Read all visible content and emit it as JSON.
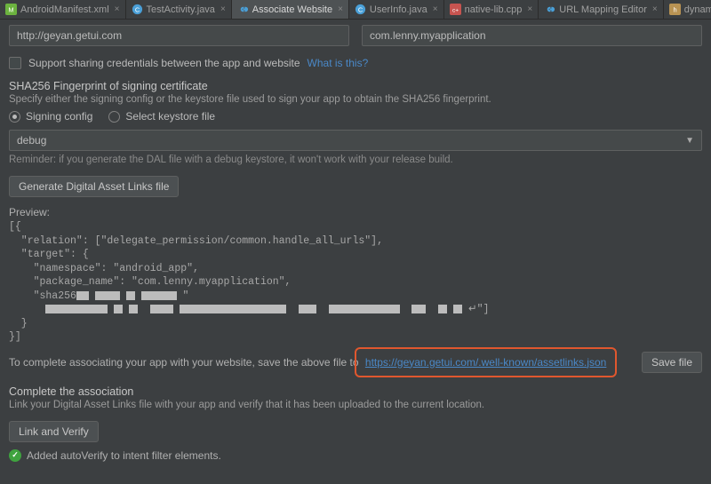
{
  "tabs": [
    {
      "label": "AndroidManifest.xml",
      "iconColor": "#6cb33f"
    },
    {
      "label": "TestActivity.java",
      "iconColor": "#4aa0d8"
    },
    {
      "label": "Associate Website",
      "iconColor": "#4aa0d8",
      "active": true
    },
    {
      "label": "UserInfo.java",
      "iconColor": "#4aa0d8"
    },
    {
      "label": "native-lib.cpp",
      "iconColor": "#c75450"
    },
    {
      "label": "URL Mapping Editor",
      "iconColor": "#4aa0d8"
    },
    {
      "label": "dynamics_load.h",
      "iconColor": "#b99353"
    }
  ],
  "fields": {
    "url": "http://geyan.getui.com",
    "package": "com.lenny.myapplication"
  },
  "shareCreds": {
    "label": "Support sharing credentials between the app and website",
    "whatIsThis": "What is this?"
  },
  "fingerprint": {
    "title": "SHA256 Fingerprint of signing certificate",
    "desc": "Specify either the signing config or the keystore file used to sign your app to obtain the SHA256 fingerprint.",
    "radioSigning": "Signing config",
    "radioKeystore": "Select keystore file",
    "selected": "debug",
    "reminder": "Reminder: if you generate the DAL file with a debug keystore, it won't work with your release build."
  },
  "buttons": {
    "generate": "Generate Digital Asset Links file",
    "saveFile": "Save file",
    "linkVerify": "Link and Verify"
  },
  "preview": {
    "label": "Preview:",
    "lines": {
      "l0": "[{",
      "l1": "  \"relation\": [\"delegate_permission/common.handle_all_urls\"],",
      "l2": "  \"target\": {",
      "l3": "    \"namespace\": \"android_app\",",
      "l4": "    \"package_name\": \"com.lenny.myapplication\",",
      "l5a": "    \"sha256",
      "l5b": "\"",
      "l6": "  }",
      "l7": "}]"
    }
  },
  "complete": {
    "text": "To complete associating your app with your website, save the above file to ",
    "link": "https://geyan.getui.com/.well-known/assetlinks.json"
  },
  "association": {
    "title": "Complete the association",
    "desc": "Link your Digital Asset Links file with your app and verify that it has been uploaded to the current location."
  },
  "status": {
    "ok": "Added autoVerify to intent filter elements."
  }
}
